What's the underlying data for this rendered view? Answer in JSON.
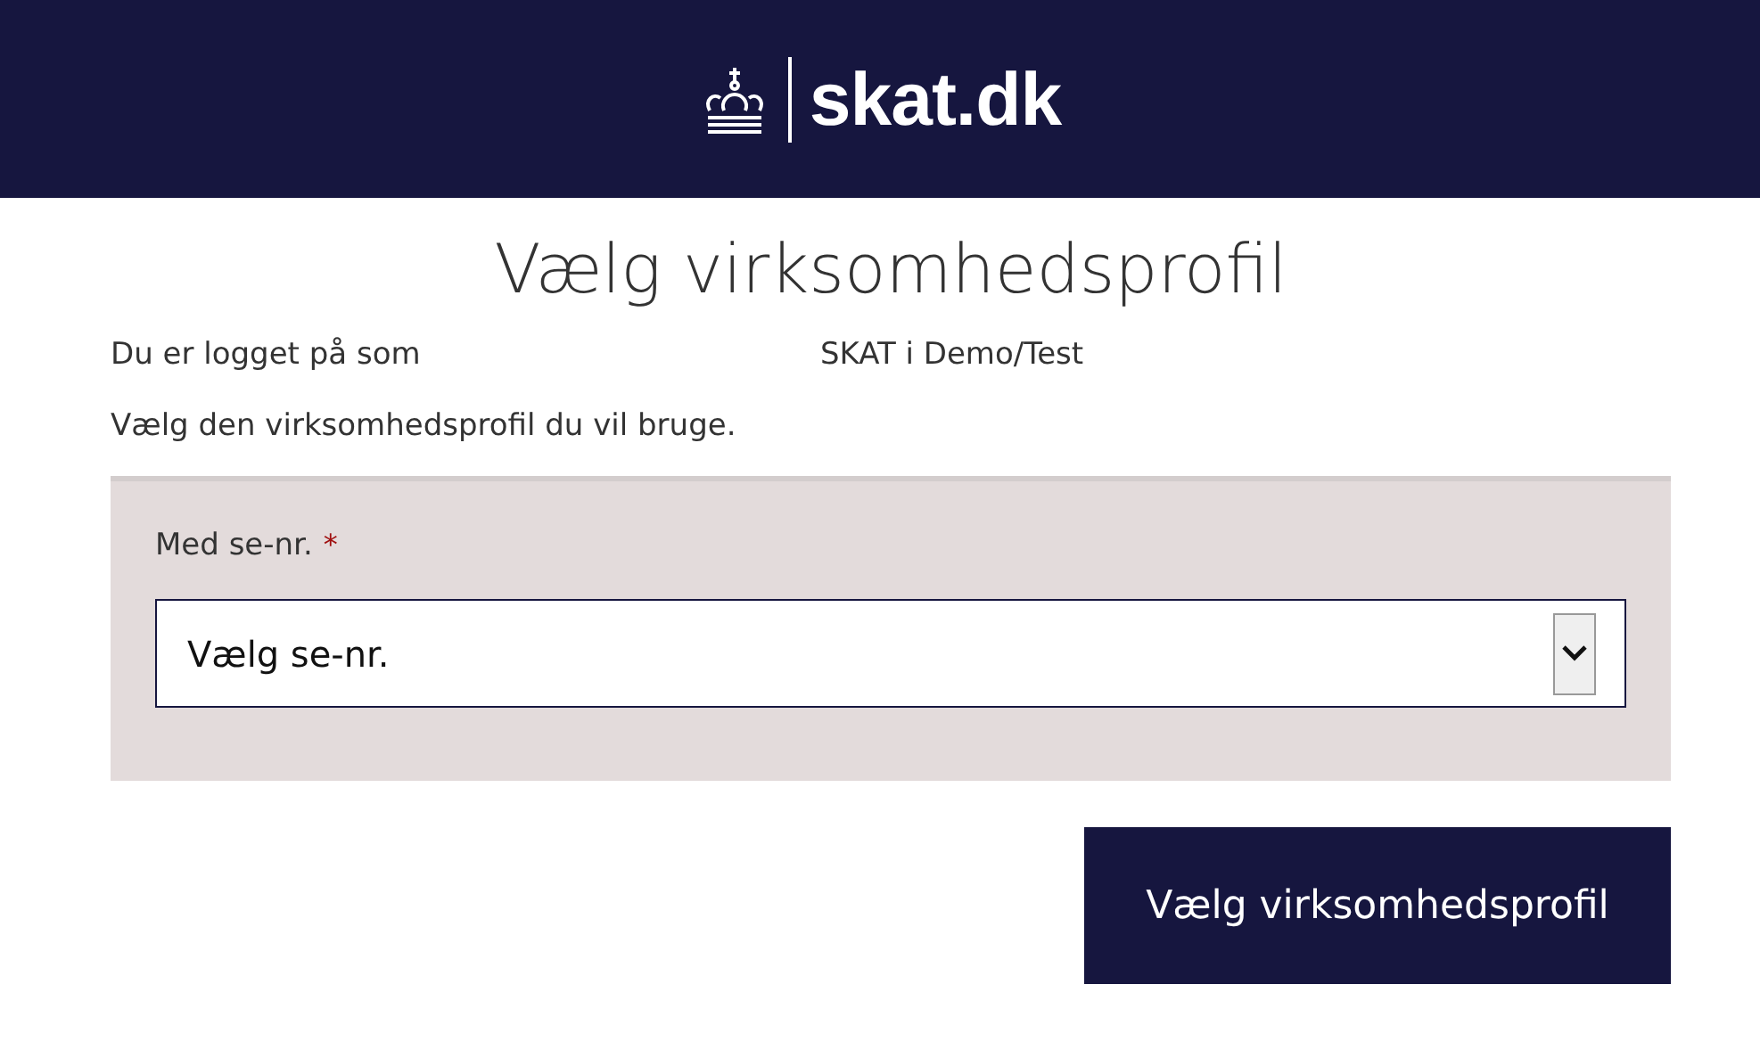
{
  "header": {
    "logo_text": "skat.dk"
  },
  "title": "Vælg virksomhedsprofil",
  "login": {
    "label": "Du er logget på som",
    "value": "SKAT i Demo/Test"
  },
  "instruction": "Vælg den virksomhedsprofil du vil bruge.",
  "form": {
    "label": "Med se-nr.",
    "required_mark": "*",
    "select_value": "Vælg se-nr."
  },
  "buttons": [
    "Vælg virksomhedsprofil"
  ]
}
